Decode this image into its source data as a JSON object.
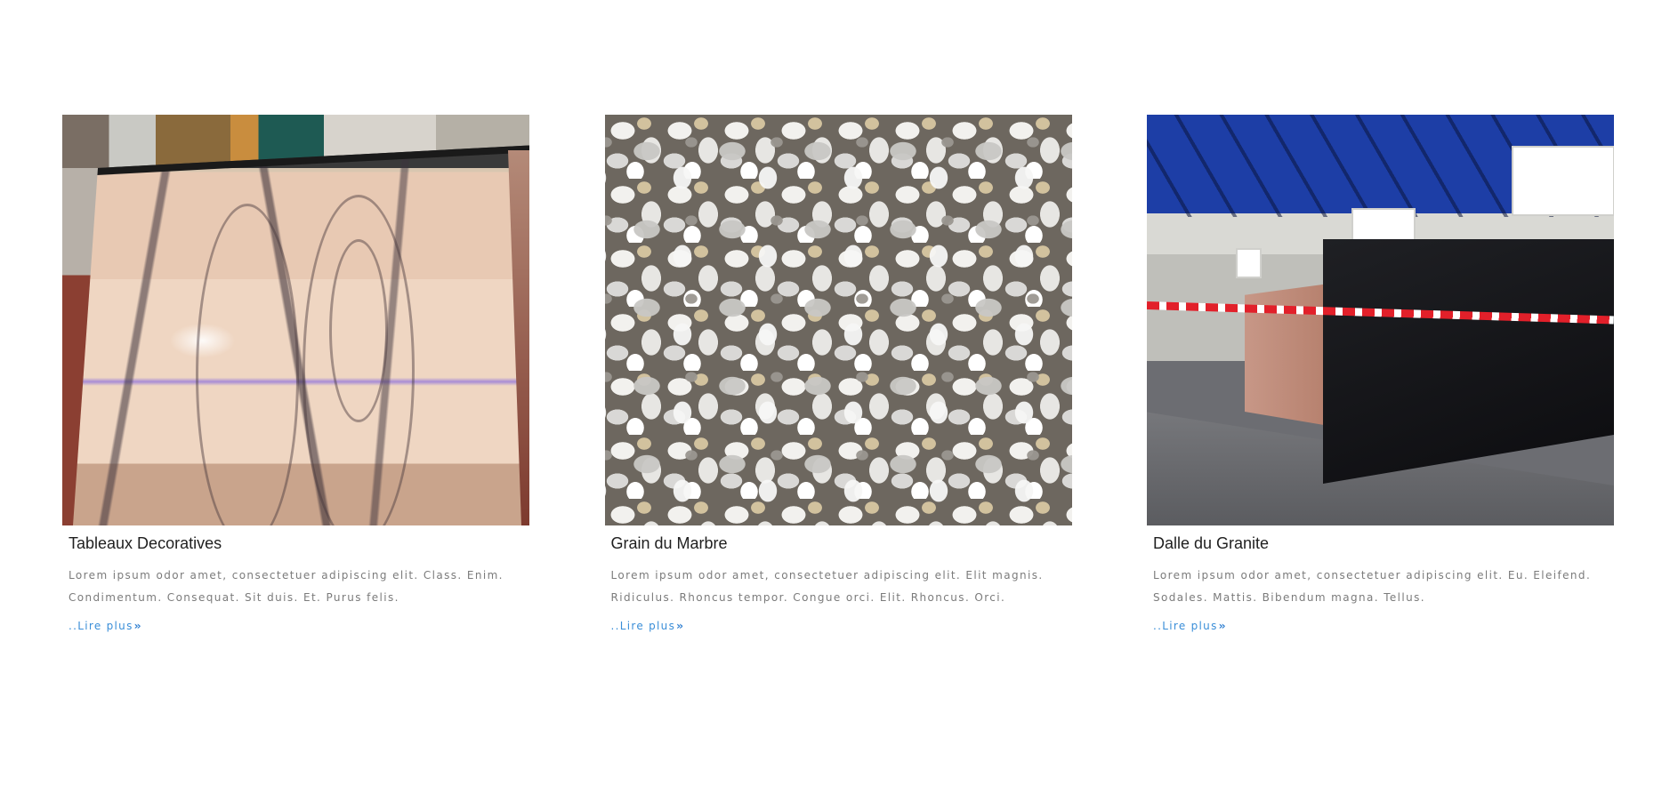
{
  "cards": [
    {
      "title": "Tableaux Decoratives",
      "description": "Lorem ipsum odor amet, consectetuer adipiscing elit. Class. Enim. Condimentum. Consequat. Sit duis. Et. Purus felis.",
      "link_label": "..Lire plus",
      "link_icon": "double-chevron-right-icon",
      "image_alt": "marble slab"
    },
    {
      "title": "Grain du Marbre",
      "description": "Lorem ipsum odor amet, consectetuer adipiscing elit. Elit magnis. Ridiculus. Rhoncus tempor. Congue orci. Elit. Rhoncus. Orci.",
      "link_label": "..Lire plus",
      "link_icon": "double-chevron-right-icon",
      "image_alt": "marble gravel"
    },
    {
      "title": "Dalle du Granite",
      "description": "Lorem ipsum odor amet, consectetuer adipiscing elit. Eu. Eleifend. Sodales. Mattis. Bibendum magna. Tellus.",
      "link_label": "..Lire plus",
      "link_icon": "double-chevron-right-icon",
      "image_alt": "granite slabs in warehouse"
    }
  ],
  "colors": {
    "link": "#3a8ed8",
    "title": "#1f1f1f",
    "body_text": "#7b7b7b",
    "background": "#ffffff"
  }
}
